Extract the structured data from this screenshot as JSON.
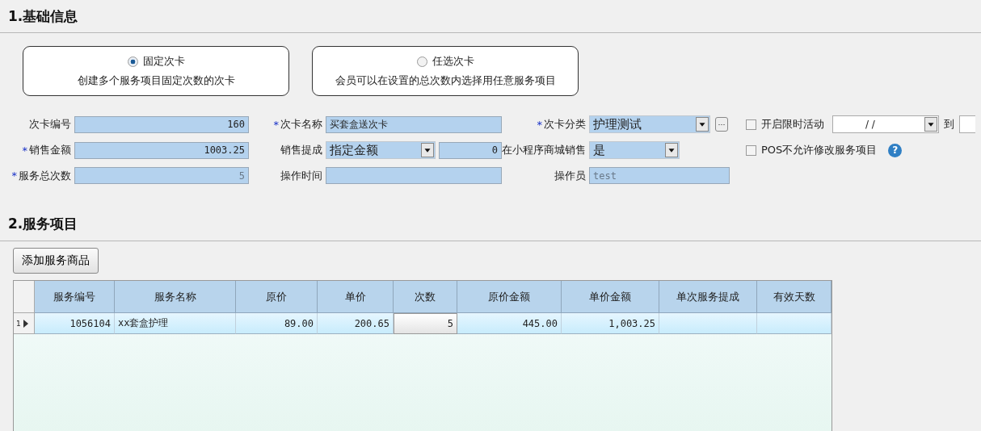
{
  "basic_info": {
    "title": "1.基础信息",
    "card_types": [
      {
        "label": "固定次卡",
        "description": "创建多个服务项目固定次数的次卡",
        "selected": true
      },
      {
        "label": "任选次卡",
        "description": "会员可以在设置的总次数内选择用任意服务项目",
        "selected": false
      }
    ],
    "rows": [
      [
        {
          "kind": "number",
          "label": "次卡编号",
          "value": "160"
        },
        {
          "kind": "text",
          "label": "次卡名称",
          "required_mark": "*",
          "value": "买套盒送次卡"
        },
        {
          "kind": "select_more",
          "label": "次卡分类",
          "required_mark": "*",
          "value": "护理测试",
          "more": "···"
        },
        {
          "kind": "date_range",
          "label": "开启限时活动",
          "checked": false,
          "value": "/  /",
          "separator": "到"
        }
      ],
      [
        {
          "kind": "number",
          "label": "销售金额",
          "required_mark": "*",
          "value": "1003.25"
        },
        {
          "kind": "select_amount",
          "label": "销售提成",
          "value": "指定金额",
          "amount": "0"
        },
        {
          "kind": "select",
          "label": "在小程序商城销售",
          "value": "是"
        },
        {
          "kind": "check_help",
          "label": "POS不允许修改服务项目",
          "checked": false,
          "help": "?"
        }
      ],
      [
        {
          "kind": "number",
          "label": "服务总次数",
          "required_mark": "*",
          "value": "5",
          "disabled": true
        },
        {
          "kind": "text",
          "label": "操作时间"
        },
        {
          "kind": "text",
          "label": "操作员",
          "value": "test",
          "disabled": true
        }
      ]
    ]
  },
  "services": {
    "title": "2.服务项目",
    "add_button": "添加服务商品",
    "columns": [
      "服务编号",
      "服务名称",
      "原价",
      "单价",
      "次数",
      "原价金额",
      "单价金额",
      "单次服务提成",
      "有效天数"
    ],
    "rows": [
      {
        "index": "1",
        "selected": true,
        "cells": [
          "1056104",
          "xx套盒护理",
          "89.00",
          "200.65",
          "5",
          "445.00",
          "1,003.25",
          null,
          null
        ]
      }
    ]
  }
}
